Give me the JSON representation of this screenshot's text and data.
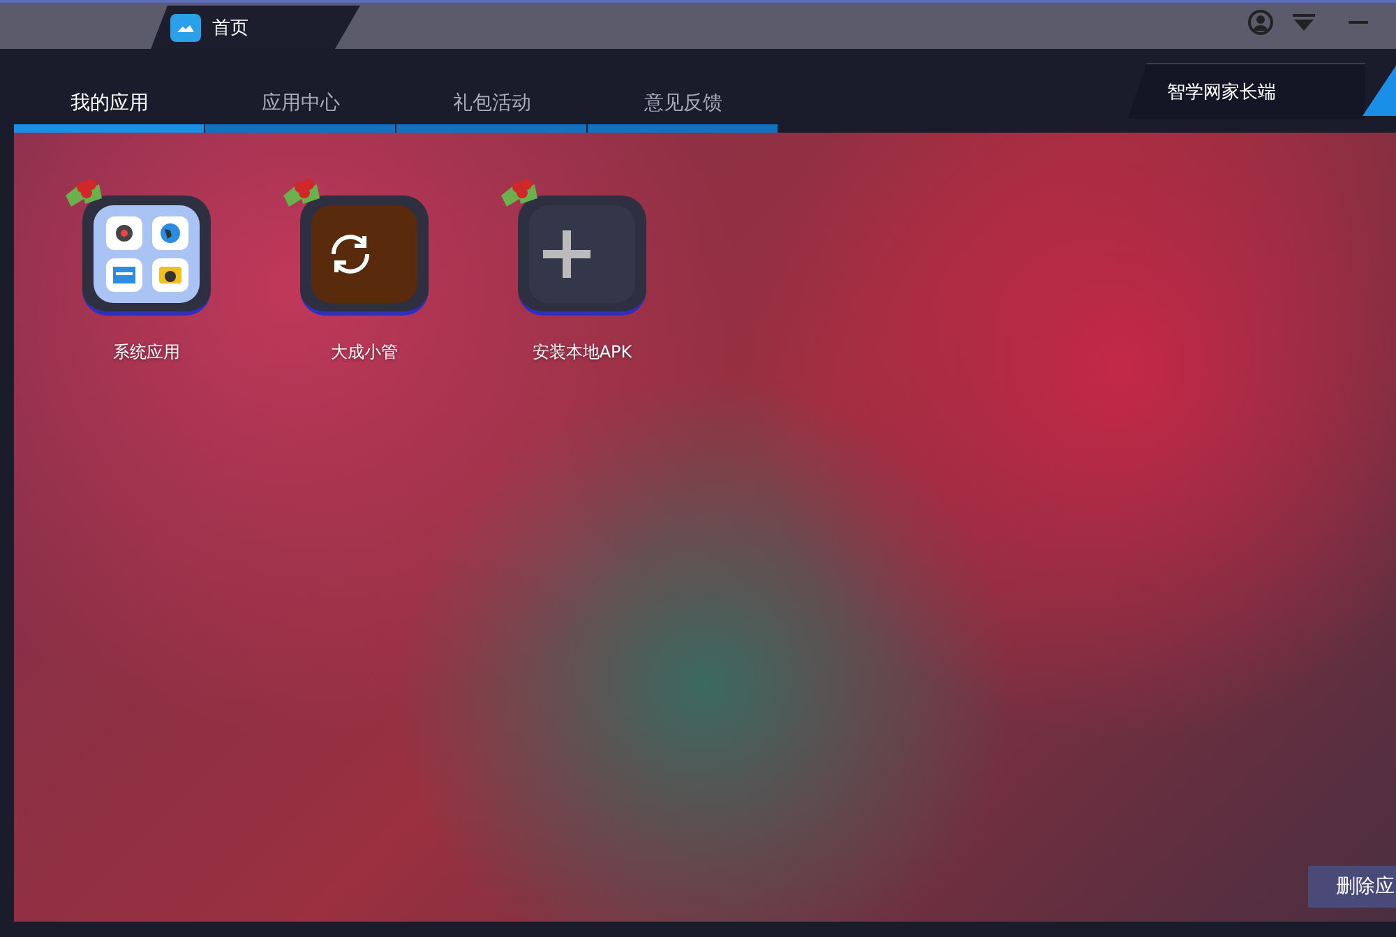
{
  "home_tab": {
    "label": "首页"
  },
  "nav_tabs": [
    {
      "label": "我的应用",
      "selected": true
    },
    {
      "label": "应用中心",
      "selected": false
    },
    {
      "label": "礼包活动",
      "selected": false
    },
    {
      "label": "意见反馈",
      "selected": false
    }
  ],
  "side_link": {
    "label": "智学网家长端"
  },
  "apps": [
    {
      "kind": "folder",
      "label": "系统应用"
    },
    {
      "kind": "sync",
      "label": "大成小管"
    },
    {
      "kind": "add",
      "label": "安装本地APK"
    }
  ],
  "delete_button": {
    "label": "删除应"
  }
}
